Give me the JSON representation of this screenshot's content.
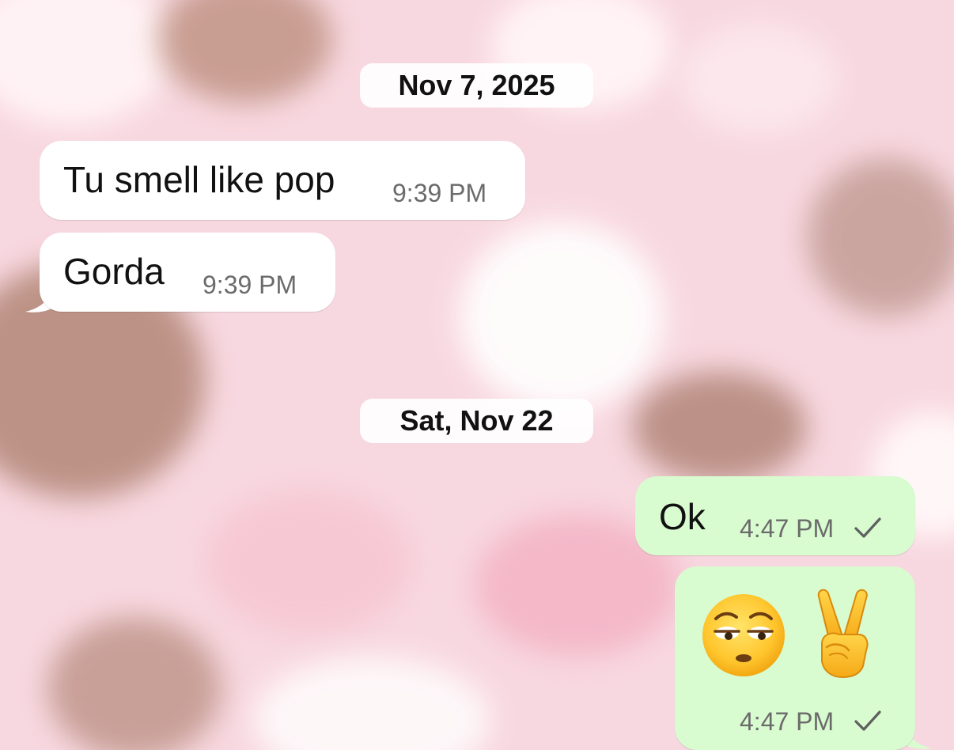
{
  "theme": {
    "wallpaper_color": "#f8d8e0",
    "incoming_bubble_color": "#ffffff",
    "outgoing_bubble_color": "#d9fbd0",
    "timestamp_color": "#6b6b6b"
  },
  "date_separators": [
    {
      "label": "Nov 7, 2025"
    },
    {
      "label": "Sat, Nov 22"
    }
  ],
  "messages": [
    {
      "direction": "incoming",
      "text": "Tu smell like pop",
      "time": "9:39 PM"
    },
    {
      "direction": "incoming",
      "text": "Gorda",
      "time": "9:39 PM"
    },
    {
      "direction": "outgoing",
      "text": "Ok",
      "time": "4:47 PM",
      "status_icon": "check-icon"
    },
    {
      "direction": "outgoing",
      "emojis": [
        "pensive-face-icon",
        "victory-hand-icon"
      ],
      "time": "4:47 PM",
      "status_icon": "check-icon"
    }
  ]
}
